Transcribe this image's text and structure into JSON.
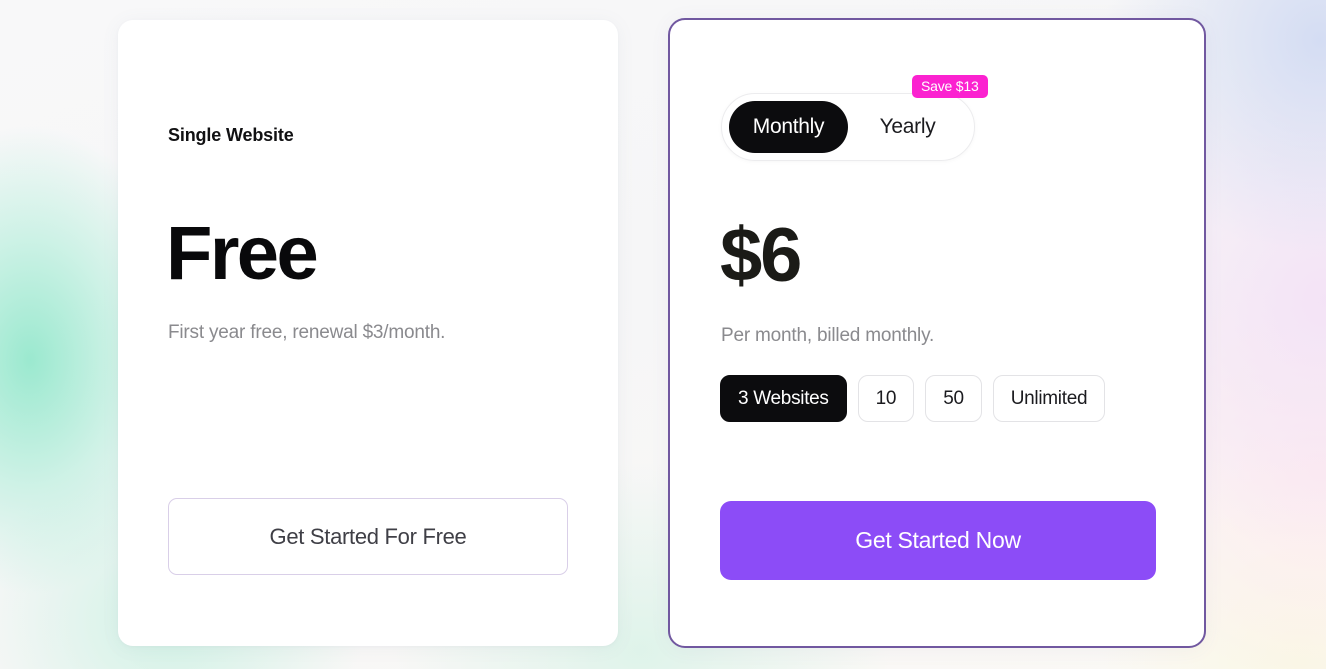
{
  "theme": {
    "accent_purple": "#8c4cf7",
    "accent_magenta": "#fb22d0",
    "card_border_purple": "#7158a0",
    "text_dark": "#09090b",
    "text_muted": "#8a8a8e"
  },
  "plans": {
    "free": {
      "name": "Single Website",
      "price": "Free",
      "note": "First year free, renewal $3/month.",
      "cta": "Get Started For Free"
    },
    "pro": {
      "billing": {
        "options": [
          {
            "label": "Monthly",
            "selected": true
          },
          {
            "label": "Yearly",
            "selected": false
          }
        ],
        "save_badge": "Save $13"
      },
      "price": "$6",
      "note": "Per month, billed monthly.",
      "tiers": [
        {
          "label": "3 Websites",
          "selected": true
        },
        {
          "label": "10",
          "selected": false
        },
        {
          "label": "50",
          "selected": false
        },
        {
          "label": "Unlimited",
          "selected": false
        }
      ],
      "cta": "Get Started Now"
    }
  }
}
